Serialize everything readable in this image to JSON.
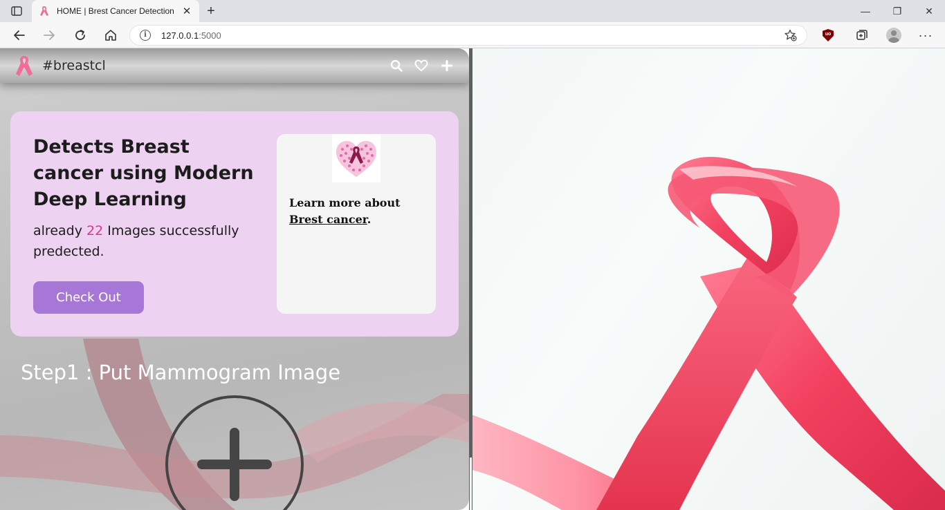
{
  "browser": {
    "tab_title": "HOME | Brest Cancer Detection",
    "tab_close": "✕",
    "new_tab": "+",
    "url_host": "127.0.0.1",
    "url_port": ":5000",
    "minimize": "—",
    "restore": "❐",
    "close": "✕",
    "more": "···"
  },
  "site": {
    "brand": "#breastcl"
  },
  "hero": {
    "title": "Detects Breast cancer using Modern Deep Learning",
    "text_before": "already ",
    "count": "22",
    "text_after": " Images successfully predected.",
    "button": "Check Out"
  },
  "info": {
    "text": "Learn more about ",
    "link": "Brest cancer",
    "period": "."
  },
  "step": {
    "title": "Step1 : Put Mammogram Image"
  },
  "colors": {
    "card_bg": "#edd3f1",
    "button_bg": "#a777d8",
    "accent_pink": "#e1358f",
    "ribbon": "#f4516e"
  }
}
